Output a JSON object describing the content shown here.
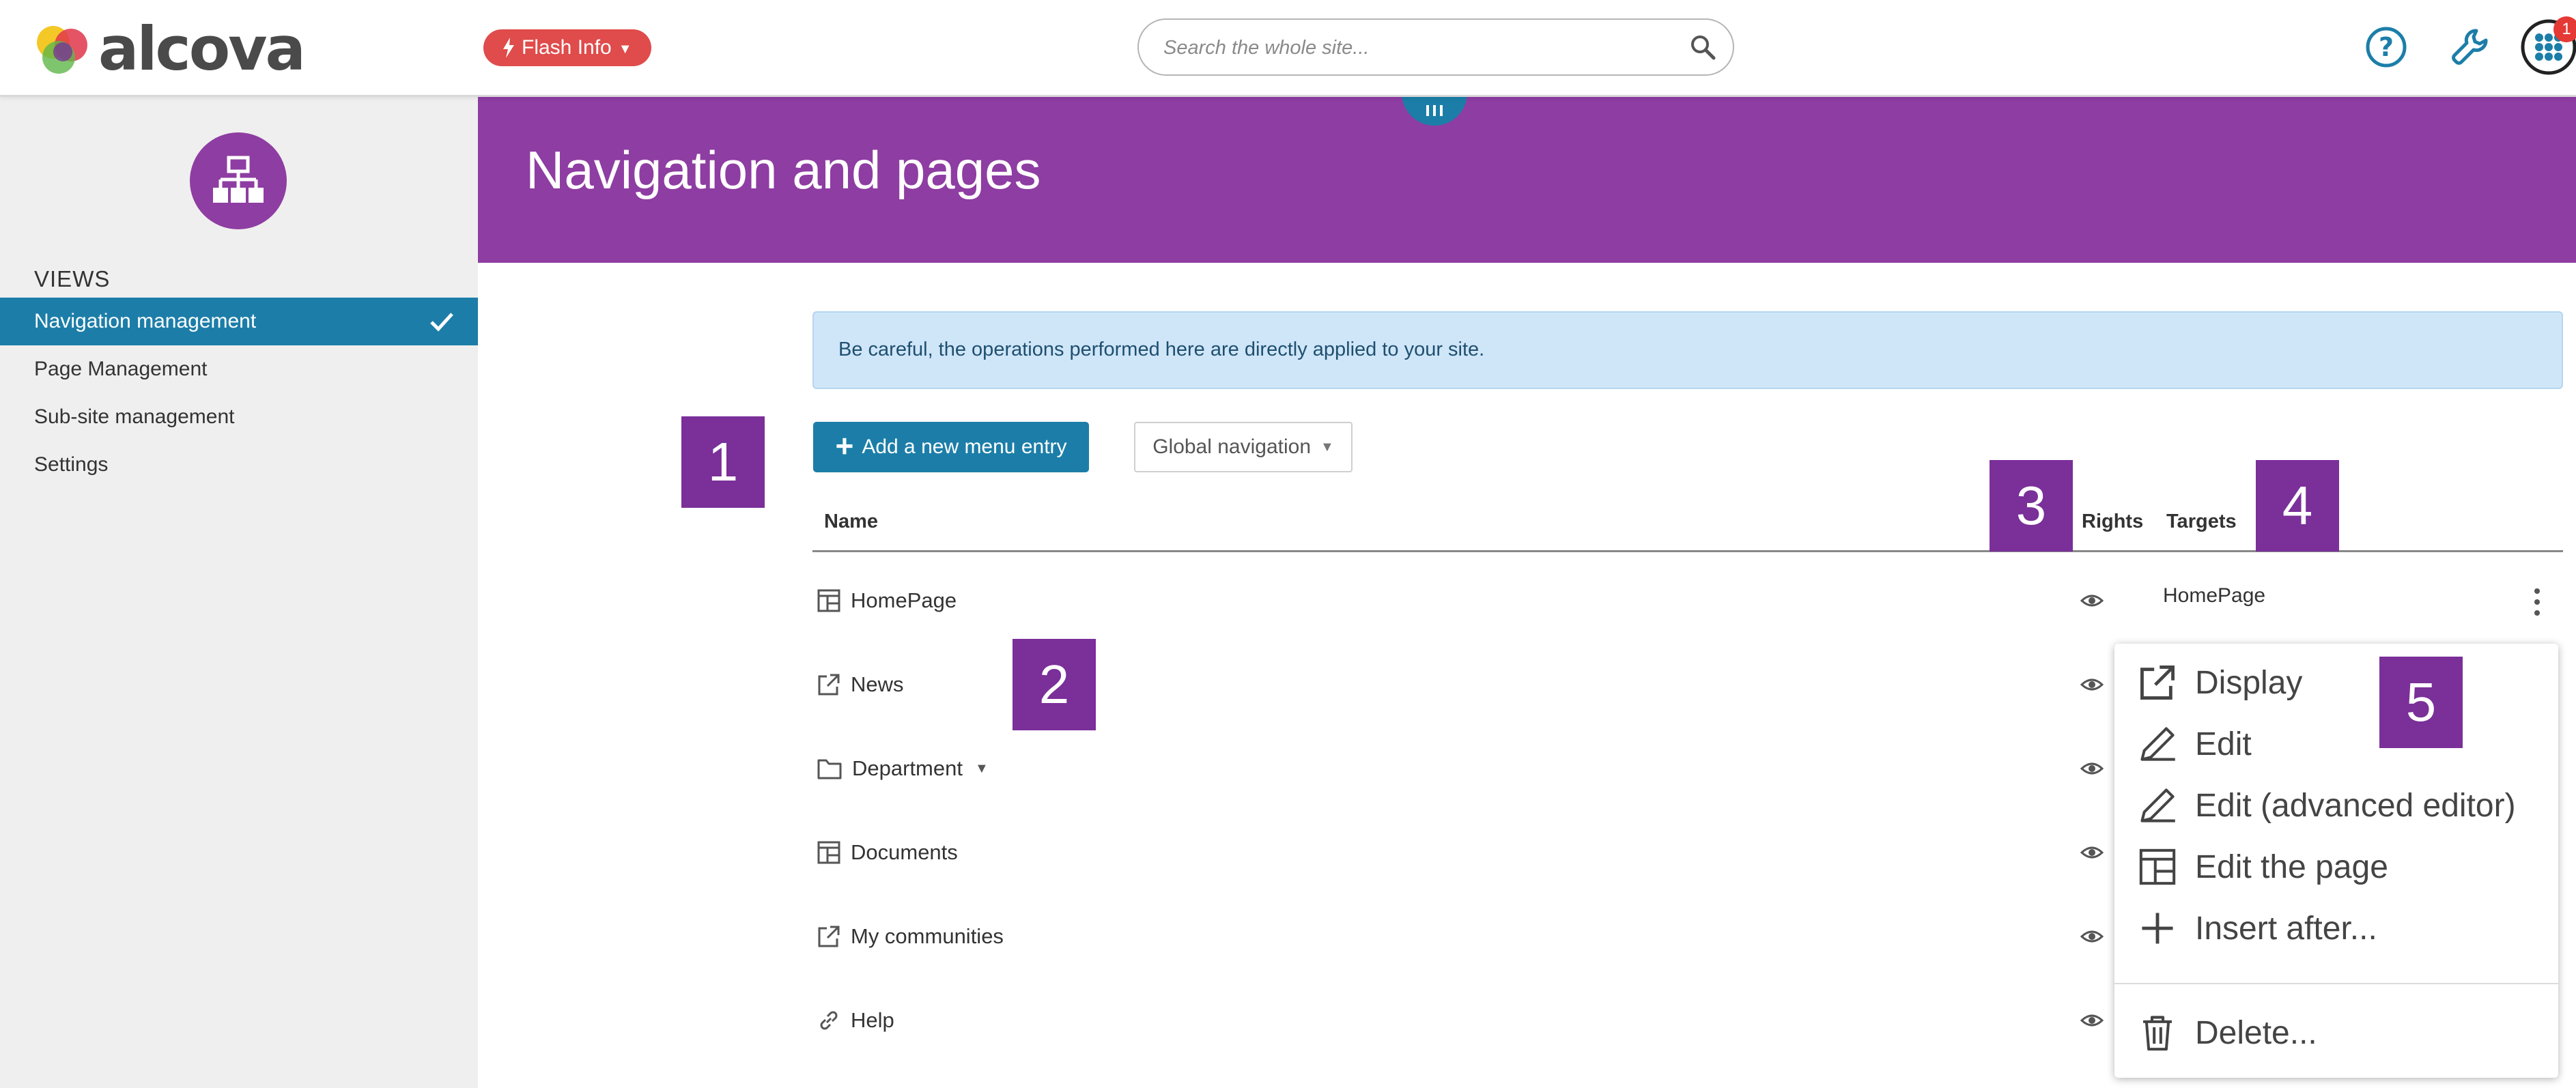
{
  "header": {
    "logo_text": "alcova",
    "flash_label": "Flash Info",
    "search_placeholder": "Search the whole site...",
    "notification_count": "1"
  },
  "sidebar": {
    "section_title": "VIEWS",
    "items": [
      {
        "label": "Navigation management",
        "active": true
      },
      {
        "label": "Page Management"
      },
      {
        "label": "Sub-site management"
      },
      {
        "label": "Settings"
      }
    ]
  },
  "banner": {
    "title": "Navigation and pages"
  },
  "alert": {
    "text": "Be careful, the operations performed here are directly applied to your site."
  },
  "toolbar": {
    "add_label": "Add a new menu entry",
    "nav_select_value": "Global navigation"
  },
  "table": {
    "headers": {
      "name": "Name",
      "rights": "Rights",
      "targets": "Targets"
    },
    "rows": [
      {
        "name": "HomePage",
        "icon": "page-layout-icon",
        "target": "HomePage"
      },
      {
        "name": "News",
        "icon": "external-link-icon"
      },
      {
        "name": "Department",
        "icon": "folder-icon"
      },
      {
        "name": "Documents",
        "icon": "page-layout-icon"
      },
      {
        "name": "My communities",
        "icon": "external-link-icon"
      },
      {
        "name": "Help",
        "icon": "link-icon"
      }
    ]
  },
  "markers": [
    "1",
    "2",
    "3",
    "4",
    "5"
  ],
  "context_menu": {
    "items": [
      {
        "label": "Display",
        "icon": "external-link-icon"
      },
      {
        "label": "Edit",
        "icon": "pencil-icon"
      },
      {
        "label": "Edit (advanced editor)",
        "icon": "pencil-icon"
      },
      {
        "label": "Edit the page",
        "icon": "page-layout-icon"
      },
      {
        "label": "Insert after...",
        "icon": "plus-icon"
      },
      {
        "label": "Delete...",
        "icon": "trash-icon"
      }
    ]
  },
  "colors": {
    "brand_purple": "#8e3da2",
    "marker_purple": "#7a2f99",
    "primary_blue": "#1c7ea8",
    "flash_red": "#e04b4b",
    "alert_bg": "#cfe6f8"
  }
}
